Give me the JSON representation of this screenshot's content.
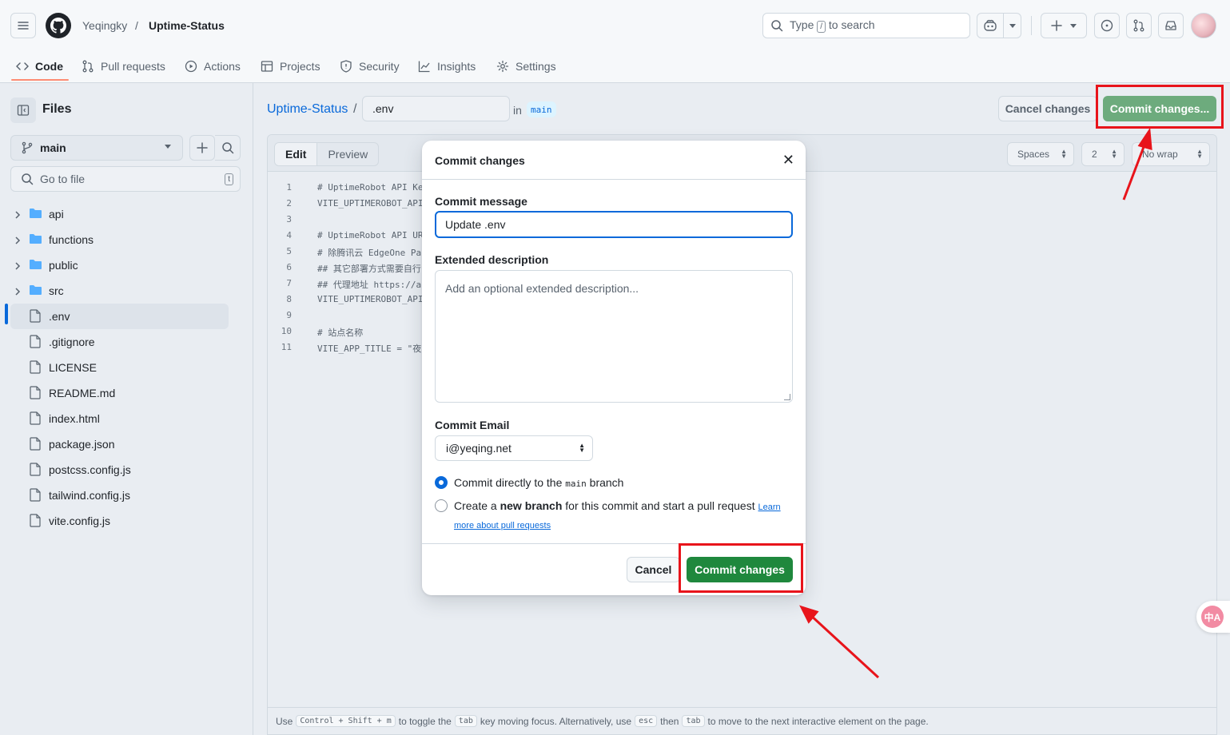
{
  "header": {
    "owner": "Yeqingky",
    "separator": "/",
    "repo": "Uptime-Status",
    "search_prefix": "Type",
    "search_key": "/",
    "search_suffix": "to search"
  },
  "tabs": [
    {
      "label": "Code",
      "icon": "code-icon",
      "active": true
    },
    {
      "label": "Pull requests",
      "icon": "git-pull-request-icon"
    },
    {
      "label": "Actions",
      "icon": "play-icon"
    },
    {
      "label": "Projects",
      "icon": "table-icon"
    },
    {
      "label": "Security",
      "icon": "shield-icon"
    },
    {
      "label": "Insights",
      "icon": "graph-icon"
    },
    {
      "label": "Settings",
      "icon": "gear-icon"
    }
  ],
  "sidebar": {
    "title": "Files",
    "branch": "main",
    "goto_placeholder": "Go to file",
    "goto_key": "t",
    "tree": [
      {
        "name": "api",
        "type": "dir"
      },
      {
        "name": "functions",
        "type": "dir"
      },
      {
        "name": "public",
        "type": "dir"
      },
      {
        "name": "src",
        "type": "dir"
      },
      {
        "name": ".env",
        "type": "file",
        "selected": true
      },
      {
        "name": ".gitignore",
        "type": "file"
      },
      {
        "name": "LICENSE",
        "type": "file"
      },
      {
        "name": "README.md",
        "type": "file"
      },
      {
        "name": "index.html",
        "type": "file"
      },
      {
        "name": "package.json",
        "type": "file"
      },
      {
        "name": "postcss.config.js",
        "type": "file"
      },
      {
        "name": "tailwind.config.js",
        "type": "file"
      },
      {
        "name": "vite.config.js",
        "type": "file"
      }
    ]
  },
  "editor_header": {
    "repo_link": "Uptime-Status",
    "slash": "/",
    "filename": ".env",
    "in_label": "in",
    "branch_tag": "main",
    "cancel_label": "Cancel changes",
    "commit_label": "Commit changes..."
  },
  "editor": {
    "mode_edit": "Edit",
    "mode_preview": "Preview",
    "indent_mode": "Spaces",
    "indent_size": "2",
    "wrap_mode": "No wrap",
    "lines": [
      {
        "n": "1",
        "text": "# UptimeRobot API Ke"
      },
      {
        "n": "2",
        "text": "VITE_UPTIMEROBOT_API"
      },
      {
        "n": "3",
        "text": ""
      },
      {
        "n": "4",
        "text": "# UptimeRobot API UR"
      },
      {
        "n": "5",
        "text": "# 除腾讯云 EdgeOne Pa"
      },
      {
        "n": "6",
        "text": "## 其它部署方式需要自行"
      },
      {
        "n": "7",
        "text": "## 代理地址 https://a"
      },
      {
        "n": "8",
        "text": "VITE_UPTIMEROBOT_API"
      },
      {
        "n": "9",
        "text": ""
      },
      {
        "n": "10",
        "text": "# 站点名称"
      },
      {
        "n": "11",
        "text": "VITE_APP_TITLE = \"夜"
      }
    ],
    "footer": {
      "use": "Use",
      "k_combo": "Control + Shift + m",
      "t1": "to toggle the",
      "k_tab": "tab",
      "t2": "key moving focus. Alternatively, use",
      "k_esc": "esc",
      "t3": "then",
      "k_tab2": "tab",
      "t4": "to move to the next interactive element on the page."
    }
  },
  "modal": {
    "title": "Commit changes",
    "close_glyph": "✕",
    "message_label": "Commit message",
    "message_value": "Update .env",
    "desc_label": "Extended description",
    "desc_placeholder": "Add an optional extended description...",
    "email_label": "Commit Email",
    "email_value": "i@yeqing.net",
    "opt1_pre": "Commit directly to the",
    "opt1_branch": "main",
    "opt1_post": "branch",
    "opt2_pre": "Create a",
    "opt2_bold": "new branch",
    "opt2_post": "for this commit and start a pull request",
    "opt2_link1": "Learn",
    "opt2_link2": "more about pull requests",
    "cancel_label": "Cancel",
    "commit_label": "Commit changes"
  },
  "translate_badge": "中A",
  "colors": {
    "primary_green": "#1f883d",
    "disabled_green": "#6dab7d",
    "accent_blue": "#0969da",
    "annotation_red": "#e8141b"
  }
}
